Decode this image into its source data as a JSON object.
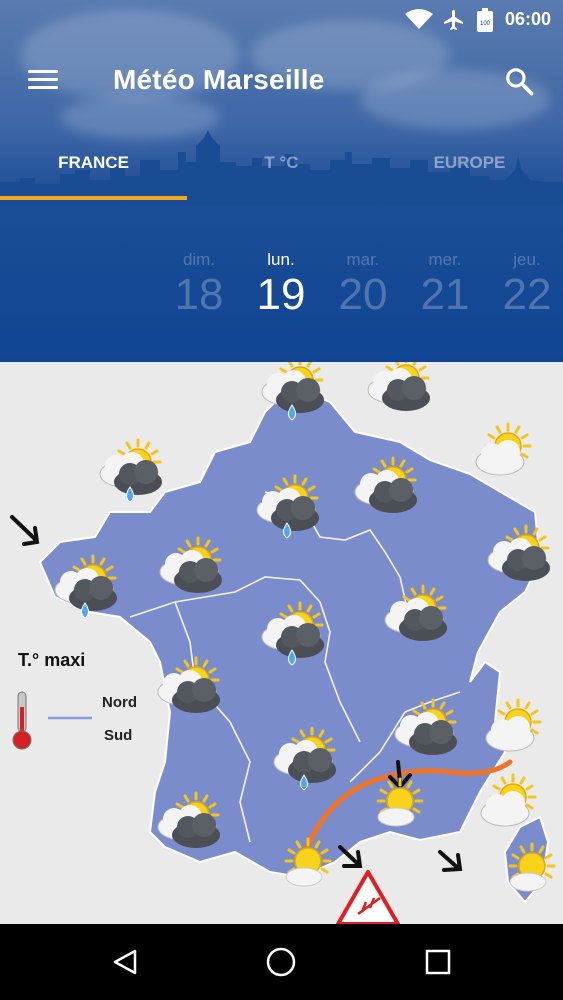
{
  "status_bar": {
    "time": "06:00",
    "battery": "100"
  },
  "app_bar": {
    "title": "Météo Marseille"
  },
  "tabs": [
    {
      "label": "FRANCE",
      "active": true
    },
    {
      "label": "T °C",
      "active": false
    },
    {
      "label": "EUROPE",
      "active": false
    }
  ],
  "days": [
    {
      "name": "dim.",
      "number": "18",
      "selected": false
    },
    {
      "name": "lun.",
      "number": "19",
      "selected": true
    },
    {
      "name": "mar.",
      "number": "20",
      "selected": false
    },
    {
      "name": "mer.",
      "number": "21",
      "selected": false
    },
    {
      "name": "jeu.",
      "number": "22",
      "selected": false
    }
  ],
  "map": {
    "legend_title": "T.° maxi",
    "legend_north": "Nord",
    "legend_south": "Sud"
  },
  "colors": {
    "accent": "#f2a91e",
    "header": "#0f4593",
    "france": "#7b8ccd"
  },
  "icons": [
    "menu-icon",
    "search-icon",
    "wifi-icon",
    "airplane-icon",
    "battery-icon",
    "back-icon",
    "home-icon",
    "recents-icon"
  ]
}
